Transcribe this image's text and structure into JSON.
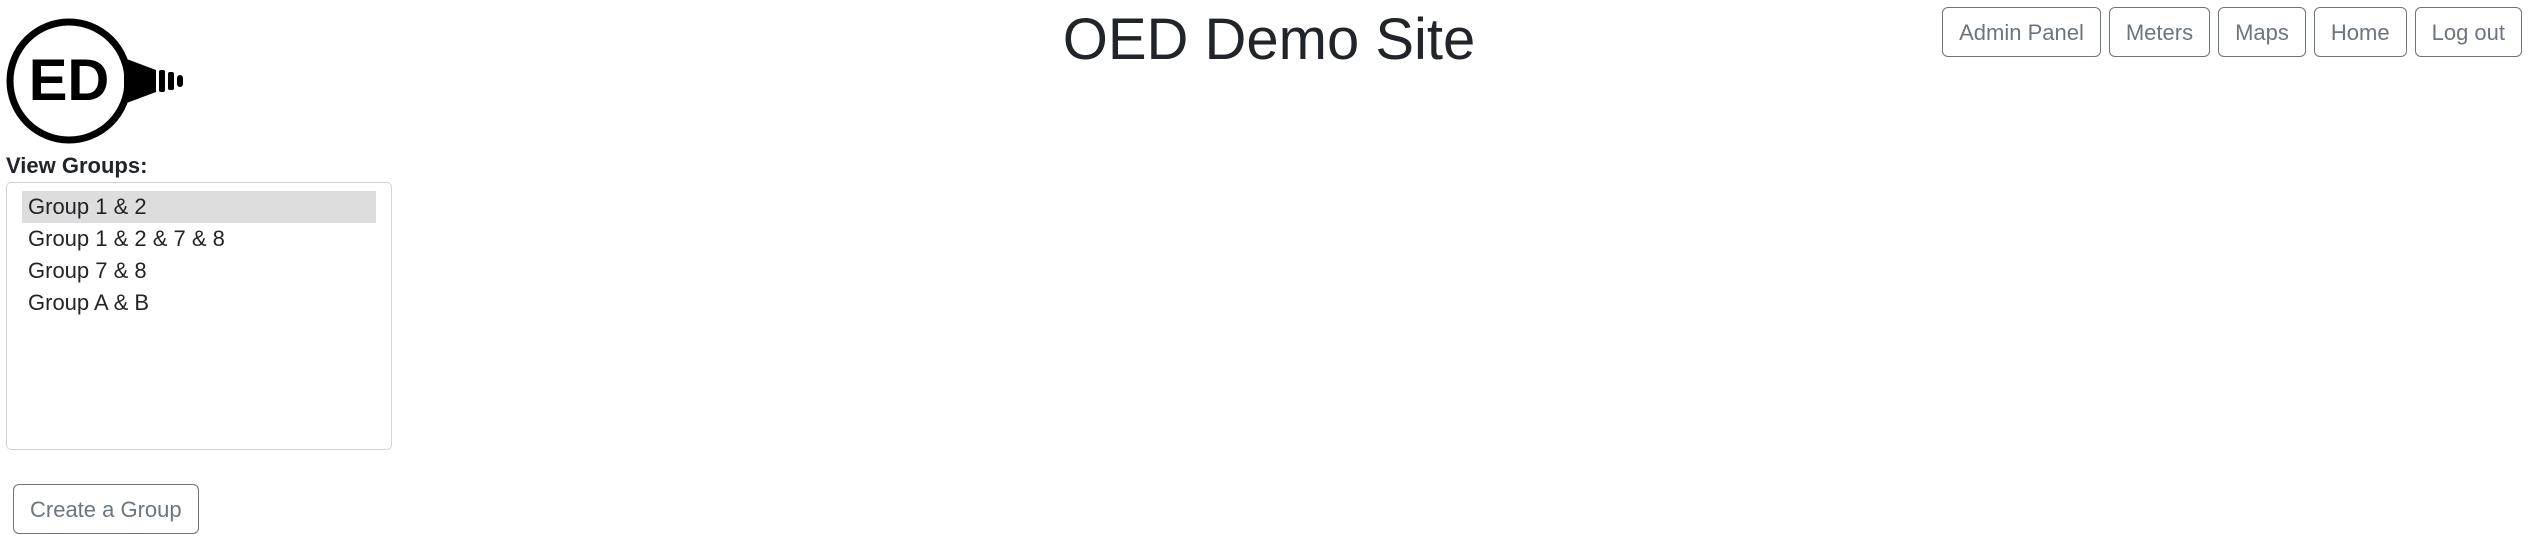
{
  "header": {
    "title": "OED Demo Site",
    "logo_text": "ED",
    "logo_icon": "lightbulb-logo-icon"
  },
  "nav": {
    "items": [
      {
        "label": "Admin Panel"
      },
      {
        "label": "Meters"
      },
      {
        "label": "Maps"
      },
      {
        "label": "Home"
      },
      {
        "label": "Log out"
      }
    ]
  },
  "groups": {
    "label": "View Groups:",
    "options": [
      {
        "label": "Group 1 & 2",
        "selected": true
      },
      {
        "label": "Group 1 & 2 & 7 & 8",
        "selected": false
      },
      {
        "label": "Group 7 & 8",
        "selected": false
      },
      {
        "label": "Group A & B",
        "selected": false
      }
    ],
    "create_label": "Create a Group"
  },
  "colors": {
    "button_border": "#6c757d",
    "selected_bg": "#dddddd",
    "list_border": "#ced4da",
    "text": "#212529"
  }
}
